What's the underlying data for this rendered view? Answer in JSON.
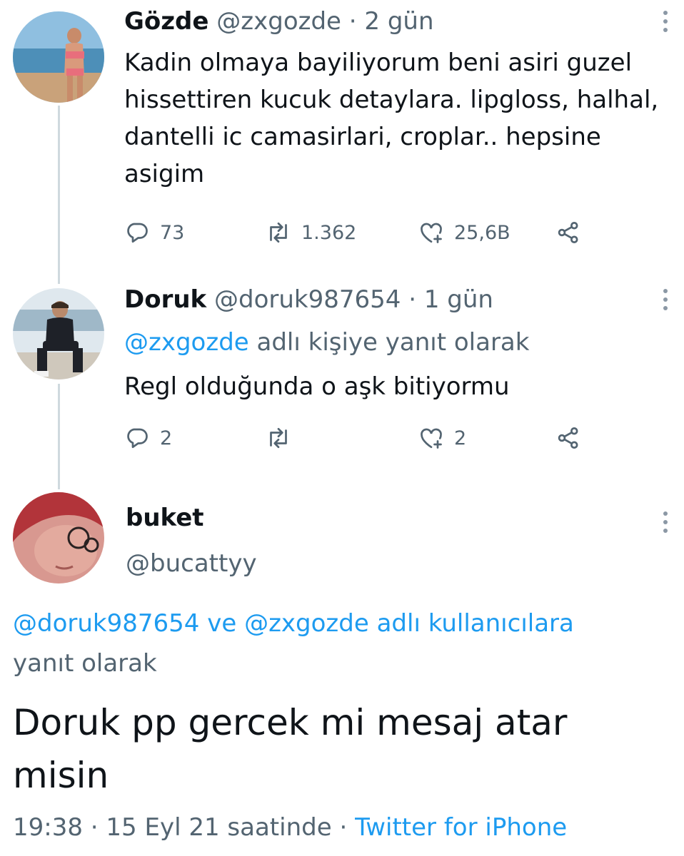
{
  "colors": {
    "text": "#0f1419",
    "muted": "#536471",
    "link": "#1d9bf0",
    "thread_line": "#cfd9de"
  },
  "tweet1": {
    "display_name": "Gözde",
    "handle": "@zxgozde",
    "separator": "·",
    "time": "2 gün",
    "text": "Kadin olmaya bayiliyorum beni asiri guzel hissettiren kucuk detaylara. lipgloss, halhal, dantelli ic camasirlari, croplar.. hepsine asigim",
    "replies": "73",
    "retweets": "1.362",
    "likes": "25,6B"
  },
  "tweet2": {
    "display_name": "Doruk",
    "handle": "@doruk987654",
    "separator": "·",
    "time": "1 gün",
    "reply_to_handle": "@zxgozde",
    "reply_to_suffix": "adlı kişiye yanıt olarak",
    "text": "Regl olduğunda o aşk bitiyormu",
    "replies": "2",
    "retweets": "",
    "likes": "2"
  },
  "tweet3": {
    "display_name": "buket",
    "handle": "@bucattyy",
    "reply_line_handle1": "@doruk987654",
    "reply_line_and": "ve",
    "reply_line_handle2": "@zxgozde",
    "reply_line_suffix": "adlı kullanıcılara",
    "reply_line_second": "yanıt olarak",
    "text": "Doruk pp gercek mi mesaj atar misin",
    "time": "19:38",
    "separator": "·",
    "date": "15 Eyl 21 saatinde",
    "separator2": "·",
    "source": "Twitter for iPhone"
  },
  "icons": {
    "reply": "reply-icon",
    "retweet": "retweet-icon",
    "like": "like-icon",
    "share": "share-icon",
    "more": "more-icon"
  }
}
